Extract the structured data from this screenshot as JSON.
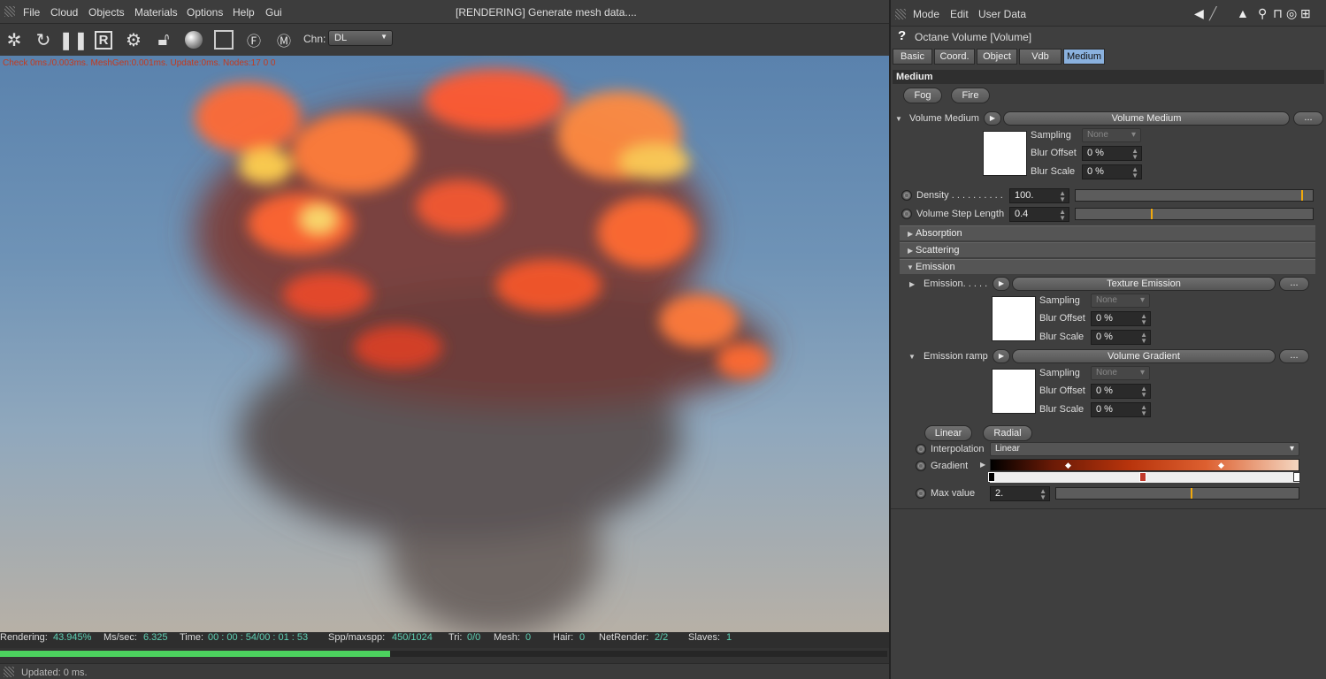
{
  "app": {
    "menu": [
      "File",
      "Cloud",
      "Objects",
      "Materials",
      "Options",
      "Help",
      "Gui"
    ],
    "title": "[RENDERING] Generate mesh data....",
    "channel_label": "Chn:",
    "channel_value": "DL",
    "stats_overlay": "Check 0ms./0.003ms. MeshGen:0.001ms. Update:0ms. Nodes:17 0 0"
  },
  "status": {
    "rendering_label": "Rendering:",
    "rendering": "43.945%",
    "mssec_label": "Ms/sec:",
    "mssec": "6.325",
    "time_label": "Time:",
    "time": "00 : 00 : 54/00 : 01 : 53",
    "spp_label": "Spp/maxspp:",
    "spp": "450/1024",
    "tri_label": "Tri:",
    "tri": "0/0",
    "mesh_label": "Mesh:",
    "mesh": "0",
    "hair_label": "Hair:",
    "hair": "0",
    "net_label": "NetRender:",
    "net": "2/2",
    "slaves_label": "Slaves:",
    "slaves": "1",
    "progress": 0.43945,
    "updated": "Updated: 0 ms."
  },
  "panel": {
    "menu": [
      "Mode",
      "Edit",
      "User Data"
    ],
    "object_title": "Octane Volume [Volume]",
    "tabs": [
      "Basic",
      "Coord.",
      "Object",
      "Vdb",
      "Medium"
    ],
    "active_tab": "Medium",
    "section": "Medium",
    "fog": "Fog",
    "fire": "Fire",
    "volume_medium_label": "Volume Medium",
    "volume_medium_btn": "Volume Medium",
    "dots": "...",
    "sampling": "Sampling",
    "sampling_value": "None",
    "blur_offset": "Blur Offset",
    "blur_scale": "Blur Scale",
    "zero_pct": "0 %",
    "density_label": "Density . . . . . . . . . .",
    "density_value": "100.",
    "density_level": 0.96,
    "step_label": "Volume Step Length",
    "step_value": "0.4",
    "step_level": 0.32,
    "absorption": "Absorption",
    "scattering": "Scattering",
    "emission": "Emission",
    "emission_label": "Emission. . . . .",
    "texture_emission": "Texture Emission",
    "ramp_label": "Emission ramp",
    "volume_gradient": "Volume Gradient",
    "linear": "Linear",
    "radial": "Radial",
    "interp_label": "Interpolation",
    "interp_value": "Linear",
    "gradient_label": "Gradient",
    "max_label": "Max value",
    "max_value": "2.",
    "max_level": 0.56
  }
}
